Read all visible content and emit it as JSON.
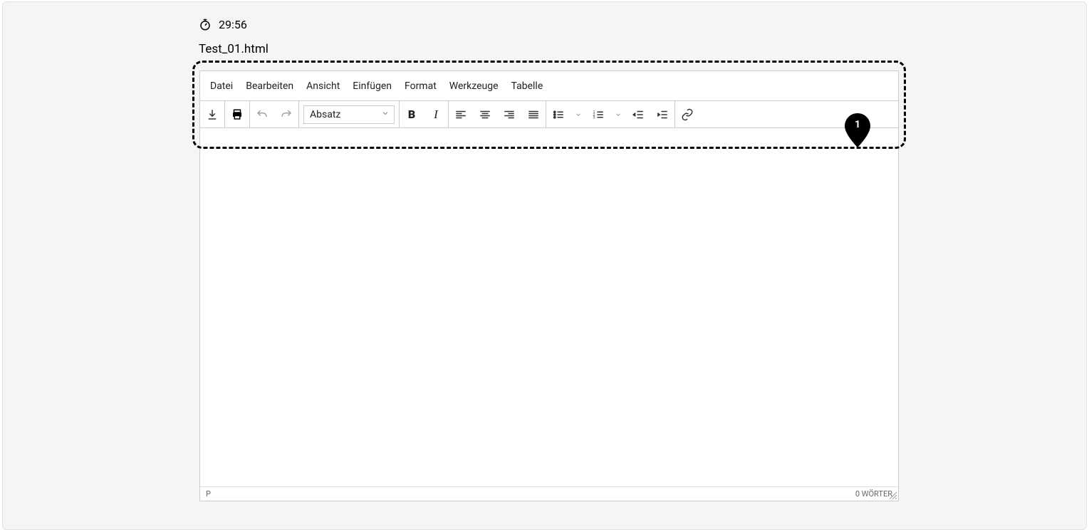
{
  "header": {
    "timer": "29:56"
  },
  "filename": "Test_01.html",
  "editor": {
    "menubar": {
      "file": "Datei",
      "edit": "Bearbeiten",
      "view": "Ansicht",
      "insert": "Einfügen",
      "format": "Format",
      "tools": "Werkzeuge",
      "table": "Tabelle"
    },
    "toolbar": {
      "format_select": "Absatz"
    },
    "status": {
      "path": "P",
      "word_count": "0 WÖRTER"
    }
  },
  "annotation": {
    "pin_label": "1"
  }
}
